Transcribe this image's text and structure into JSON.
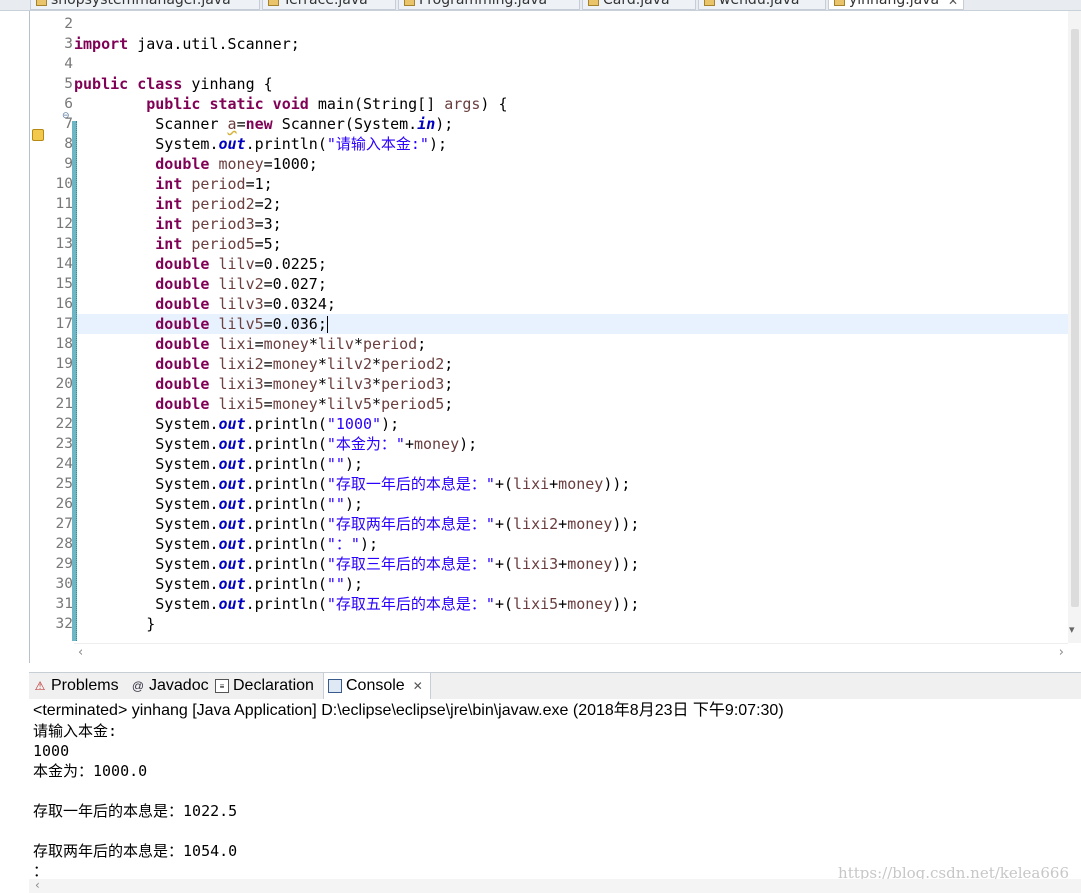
{
  "editor_tabs": [
    {
      "label": "shopsystemmanager.java"
    },
    {
      "label": "Terrace.java"
    },
    {
      "label": "Programming.java"
    },
    {
      "label": "Card.java"
    },
    {
      "label": "wendu.java"
    },
    {
      "label": "yinhang.java",
      "active": true
    }
  ],
  "code_lines": [
    {
      "n": "2",
      "html": ""
    },
    {
      "n": "3",
      "html": "<span class='kw'>import</span> java.util.Scanner;"
    },
    {
      "n": "4",
      "html": ""
    },
    {
      "n": "5",
      "html": "<span class='kw'>public class</span> yinhang {"
    },
    {
      "n": "6",
      "html": "        <span class='kw'>public static void</span> main(String[] <span class='var'>args</span>) {"
    },
    {
      "n": "7",
      "html": "         Scanner <span class='var' style='text-decoration:underline wavy #d6b13a'>a</span>=<span class='kw'>new</span> Scanner(System.<span class='fld'>in</span>);"
    },
    {
      "n": "8",
      "html": "         System.<span class='fld'>out</span>.println(<span class='str'>\"请输入本金:\"</span>);"
    },
    {
      "n": "9",
      "html": "         <span class='kw'>double</span> <span class='var'>money</span>=1000;"
    },
    {
      "n": "10",
      "html": "         <span class='kw'>int</span> <span class='var'>period</span>=1;"
    },
    {
      "n": "11",
      "html": "         <span class='kw'>int</span> <span class='var'>period2</span>=2;"
    },
    {
      "n": "12",
      "html": "         <span class='kw'>int</span> <span class='var'>period3</span>=3;"
    },
    {
      "n": "13",
      "html": "         <span class='kw'>int</span> <span class='var'>period5</span>=5;"
    },
    {
      "n": "14",
      "html": "         <span class='kw'>double</span> <span class='var'>lilv</span>=0.0225;"
    },
    {
      "n": "15",
      "html": "         <span class='kw'>double</span> <span class='var'>lilv2</span>=0.027;"
    },
    {
      "n": "16",
      "html": "         <span class='kw'>double</span> <span class='var'>lilv3</span>=0.0324;"
    },
    {
      "n": "17",
      "html": "         <span class='kw'>double</span> <span class='var'>lilv5</span>=0.036;<span class='caret'></span>"
    },
    {
      "n": "18",
      "html": "         <span class='kw'>double</span> <span class='var'>lixi</span>=<span class='var'>money</span>*<span class='var'>lilv</span>*<span class='var'>period</span>;"
    },
    {
      "n": "19",
      "html": "         <span class='kw'>double</span> <span class='var'>lixi2</span>=<span class='var'>money</span>*<span class='var'>lilv2</span>*<span class='var'>period2</span>;"
    },
    {
      "n": "20",
      "html": "         <span class='kw'>double</span> <span class='var'>lixi3</span>=<span class='var'>money</span>*<span class='var'>lilv3</span>*<span class='var'>period3</span>;"
    },
    {
      "n": "21",
      "html": "         <span class='kw'>double</span> <span class='var'>lixi5</span>=<span class='var'>money</span>*<span class='var'>lilv5</span>*<span class='var'>period5</span>;"
    },
    {
      "n": "22",
      "html": "         System.<span class='fld'>out</span>.println(<span class='str'>\"1000\"</span>);"
    },
    {
      "n": "23",
      "html": "         System.<span class='fld'>out</span>.println(<span class='str'>\"本金为：\"</span>+<span class='var'>money</span>);"
    },
    {
      "n": "24",
      "html": "         System.<span class='fld'>out</span>.println(<span class='str'>\"\"</span>);"
    },
    {
      "n": "25",
      "html": "         System.<span class='fld'>out</span>.println(<span class='str'>\"存取一年后的本息是：\"</span>+(<span class='var'>lixi</span>+<span class='var'>money</span>));"
    },
    {
      "n": "26",
      "html": "         System.<span class='fld'>out</span>.println(<span class='str'>\"\"</span>);"
    },
    {
      "n": "27",
      "html": "         System.<span class='fld'>out</span>.println(<span class='str'>\"存取两年后的本息是：\"</span>+(<span class='var'>lixi2</span>+<span class='var'>money</span>));"
    },
    {
      "n": "28",
      "html": "         System.<span class='fld'>out</span>.println(<span class='str'>\"：\"</span>);"
    },
    {
      "n": "29",
      "html": "         System.<span class='fld'>out</span>.println(<span class='str'>\"存取三年后的本息是：\"</span>+(<span class='var'>lixi3</span>+<span class='var'>money</span>));"
    },
    {
      "n": "30",
      "html": "         System.<span class='fld'>out</span>.println(<span class='str'>\"\"</span>);"
    },
    {
      "n": "31",
      "html": "         System.<span class='fld'>out</span>.println(<span class='str'>\"存取五年后的本息是：\"</span>+(<span class='var'>lixi5</span>+<span class='var'>money</span>));"
    },
    {
      "n": "32",
      "html": "        }"
    }
  ],
  "views": {
    "problems": "Problems",
    "javadoc": "Javadoc",
    "declaration": "Declaration",
    "console": "Console"
  },
  "console": {
    "header": "<terminated> yinhang [Java Application] D:\\eclipse\\eclipse\\jre\\bin\\javaw.exe (2018年8月23日 下午9:07:30)",
    "lines": [
      "请输入本金:",
      "1000",
      "本金为：1000.0",
      "",
      "存取一年后的本息是：1022.5",
      "",
      "存取两年后的本息是：1054.0",
      "："
    ]
  },
  "watermark": "https://blog.csdn.net/kelea666"
}
